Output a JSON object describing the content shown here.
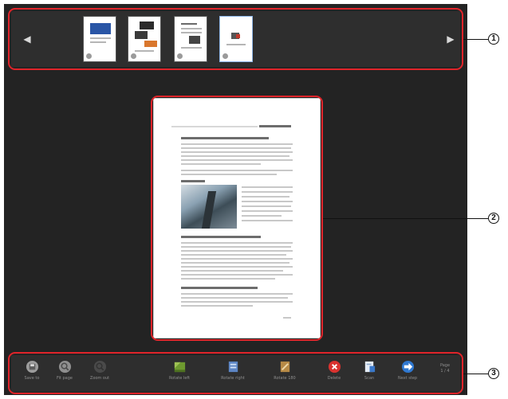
{
  "thumbnails": [
    {
      "name": "thumbnail-page-1"
    },
    {
      "name": "thumbnail-page-2"
    },
    {
      "name": "thumbnail-page-3"
    },
    {
      "name": "thumbnail-page-4"
    }
  ],
  "toolbar": {
    "buttons": [
      {
        "label": "Save to",
        "icon": "save-icon"
      },
      {
        "label": "Fit page",
        "icon": "fit-page-icon"
      },
      {
        "label": "Zoom out",
        "icon": "zoom-out-icon"
      },
      {
        "label": "Rotate left",
        "icon": "rotate-left-icon"
      },
      {
        "label": "Rotate right",
        "icon": "rotate-right-icon"
      },
      {
        "label": "Rotate 180",
        "icon": "rotate-180-icon"
      },
      {
        "label": "Delete",
        "icon": "delete-icon"
      },
      {
        "label": "Scan",
        "icon": "scan-icon"
      },
      {
        "label": "Next step",
        "icon": "next-step-icon"
      }
    ],
    "page_label": "Page",
    "page_value": "1 / 4"
  },
  "callouts": {
    "one": "1",
    "two": "2",
    "three": "3"
  },
  "colors": {
    "callout_red": "#e0242a",
    "app_background": "#232323",
    "strip_background": "#2e2e2e"
  }
}
